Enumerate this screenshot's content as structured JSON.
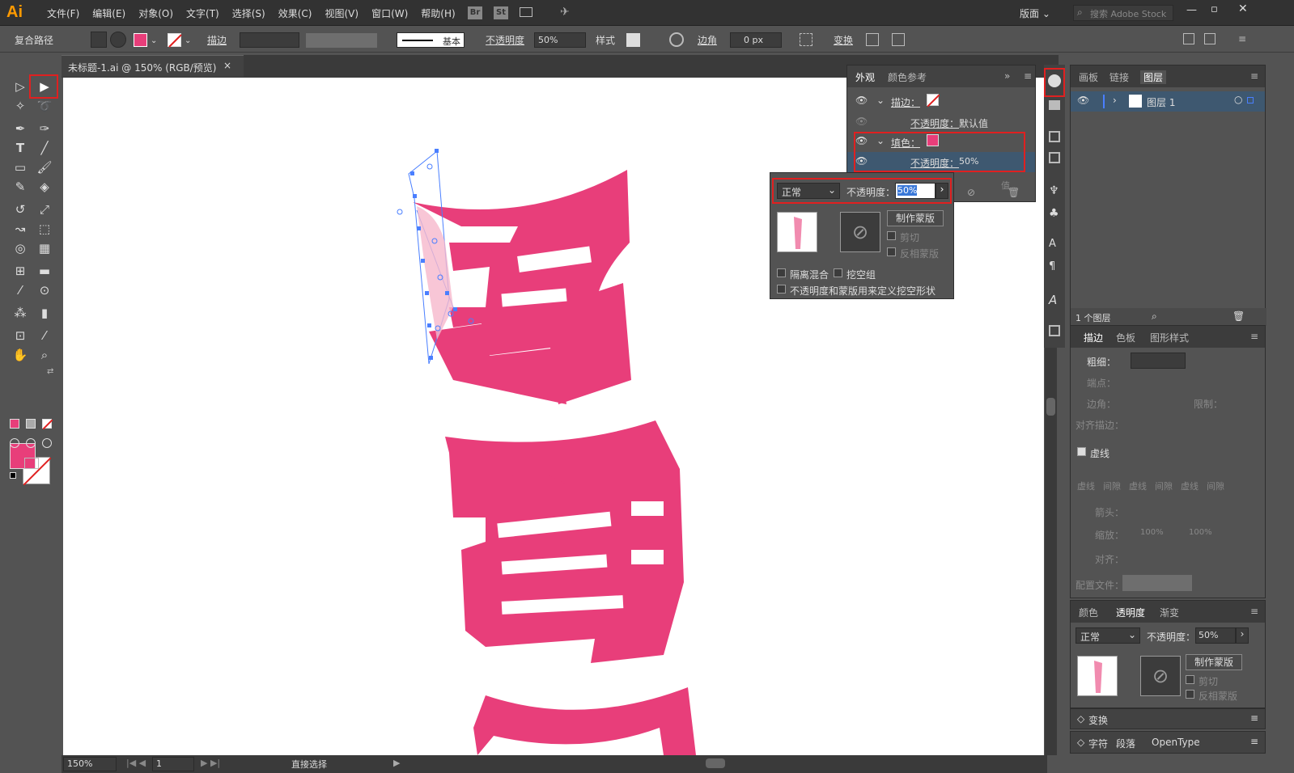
{
  "app": {
    "logo": "Ai",
    "search_placeholder": "搜索 Adobe Stock",
    "workspace": "版面"
  },
  "menu": [
    "文件(F)",
    "编辑(E)",
    "对象(O)",
    "文字(T)",
    "选择(S)",
    "效果(C)",
    "视图(V)",
    "窗口(W)",
    "帮助(H)"
  ],
  "topbar_icons": {
    "br": "Br",
    "st": "St"
  },
  "control": {
    "selection_type": "复合路径",
    "stroke_label": "描边",
    "stroke_style": "基本",
    "opacity_label": "不透明度",
    "opacity": "50%",
    "style_label": "样式",
    "corner_label": "边角",
    "corner_value": "0 px",
    "transform_label": "变换"
  },
  "document": {
    "tab_title": "未标题-1.ai @ 150% (RGB/预览)",
    "close": "×"
  },
  "status": {
    "zoom": "150%",
    "page": "1",
    "tool": "直接选择"
  },
  "appearance_panel": {
    "tabs": [
      "外观",
      "颜色参考"
    ],
    "stroke_label": "描边：",
    "stroke_opacity_label": "不透明度：",
    "stroke_opacity": "默认值",
    "fill_label": "填色：",
    "fill_opacity_label": "不透明度：",
    "fill_opacity": "50%",
    "partial_text": "值"
  },
  "transparency_popup": {
    "blend_mode": "正常",
    "opacity_label": "不透明度：",
    "opacity": "50%",
    "make_mask": "制作蒙版",
    "clip": "剪切",
    "invert_mask": "反相蒙版",
    "isolate_blending": "隔离混合",
    "knockout_group": "挖空组",
    "opacity_mask_define": "不透明度和蒙版用来定义挖空形状"
  },
  "layers_panel": {
    "tabs": [
      "画板",
      "链接",
      "图层"
    ],
    "layer_name": "图层 1",
    "layer_count": "1 个图层"
  },
  "stroke_panel": {
    "tabs": [
      "描边",
      "色板",
      "图形样式"
    ],
    "weight_label": "粗细：",
    "cap_label": "端点：",
    "corner_label": "边角：",
    "limit_label": "限制：",
    "align_label": "对齐描边：",
    "dashed_label": "虚线",
    "dash_labels": [
      "虚线",
      "间隙",
      "虚线",
      "间隙",
      "虚线",
      "间隙"
    ],
    "arrow_label": "箭头：",
    "scale_label": "缩放：",
    "scale1": "100%",
    "scale2": "100%",
    "align2_label": "对齐：",
    "profile_label": "配置文件："
  },
  "transparency_panel": {
    "tabs": [
      "颜色",
      "透明度",
      "渐变"
    ],
    "blend_mode": "正常",
    "opacity_label": "不透明度：",
    "opacity": "50%",
    "make_mask": "制作蒙版",
    "clip": "剪切",
    "invert_mask": "反相蒙版"
  },
  "collapsed_panels": {
    "transform": "变换",
    "character": "字符",
    "paragraph": "段落",
    "opentype": "OpenType"
  },
  "colors": {
    "fill": "#e83e7a",
    "selection": "#4a7fff",
    "highlight": "#e02020",
    "ui_dark": "#323232"
  }
}
